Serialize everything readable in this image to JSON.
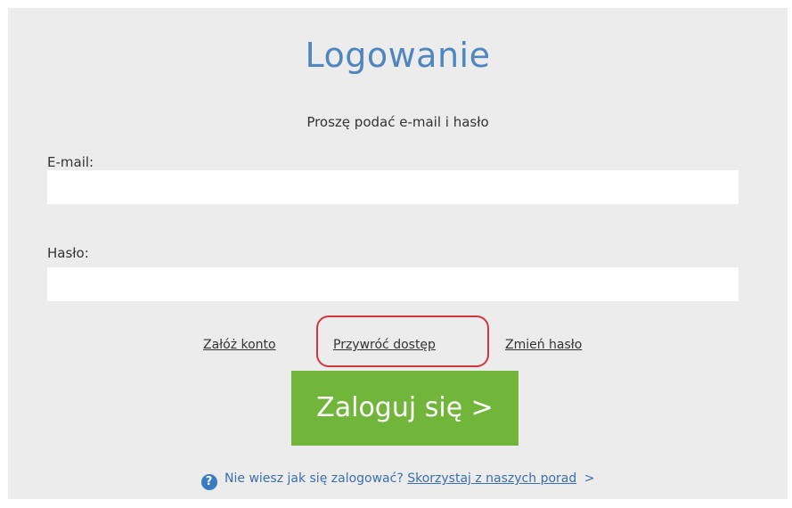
{
  "login": {
    "title": "Logowanie",
    "subtitle": "Proszę podać e-mail i hasło",
    "email_label": "E-mail:",
    "email_value": "",
    "password_label": "Hasło:",
    "password_value": ""
  },
  "links": {
    "create_account": "Załóż konto",
    "restore_access": "Przywróć dostęp",
    "change_password": "Zmień hasło"
  },
  "button": {
    "login_label": "Zaloguj się >"
  },
  "help": {
    "icon": "?",
    "question": "Nie wiesz jak się zalogować?",
    "link": "Skorzystaj z naszych porad",
    "arrow": ">"
  },
  "colors": {
    "title": "#4f86c0",
    "panel_background": "#ececec",
    "button": "#72b53b",
    "highlight": "#d0393e",
    "help_link": "#3a6fb0"
  }
}
